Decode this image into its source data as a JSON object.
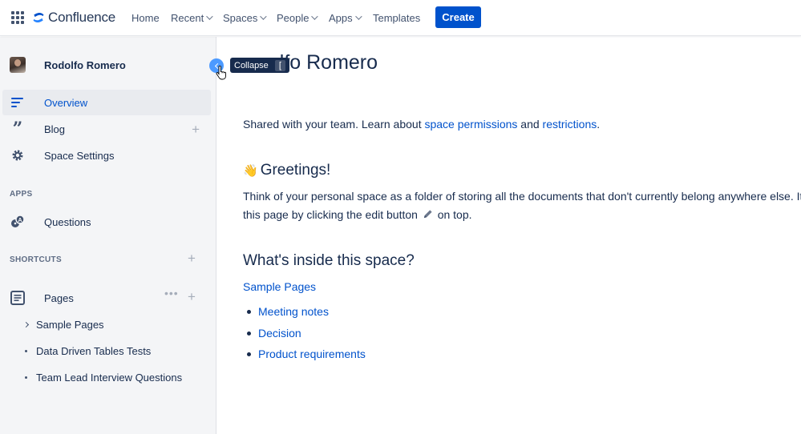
{
  "nav": {
    "brand": "Confluence",
    "items": [
      {
        "label": "Home",
        "has_dropdown": false
      },
      {
        "label": "Recent",
        "has_dropdown": true
      },
      {
        "label": "Spaces",
        "has_dropdown": true
      },
      {
        "label": "People",
        "has_dropdown": true
      },
      {
        "label": "Apps",
        "has_dropdown": true
      },
      {
        "label": "Templates",
        "has_dropdown": false
      }
    ],
    "create_label": "Create"
  },
  "sidebar": {
    "space_name": "Rodolfo Romero",
    "items": [
      {
        "label": "Overview",
        "icon": "overview-lines-icon",
        "active": true
      },
      {
        "label": "Blog",
        "icon": "quote-icon",
        "active": false
      },
      {
        "label": "Space Settings",
        "icon": "gear-icon",
        "active": false
      }
    ],
    "apps_title": "APPS",
    "apps": [
      {
        "label": "Questions",
        "icon": "questions-icon"
      }
    ],
    "shortcuts_title": "SHORTCUTS",
    "pages_label": "Pages",
    "tree": [
      {
        "label": "Sample Pages",
        "expandable": true
      },
      {
        "label": "Data Driven Tables Tests",
        "expandable": false
      },
      {
        "label": "Team Lead Interview Questions",
        "expandable": false
      }
    ]
  },
  "tooltip": {
    "text": "Collapse",
    "shortcut": "["
  },
  "content": {
    "title": "lfo Romero",
    "shared_prefix": "Shared with your team. Learn about ",
    "shared_link1": "space permissions",
    "shared_and": " and ",
    "shared_link2": "restrictions",
    "shared_suffix": ".",
    "greeting_emoji": "👋",
    "greeting_heading": "Greetings!",
    "greeting_line1": "Think of your personal space as a folder of storing all the documents that don't currently belong anywhere else. It's al",
    "greeting_line2a": "this page by clicking the edit button",
    "greeting_line2b": "on top.",
    "inside_heading": "What's inside this space?",
    "sample_pages_link": "Sample Pages",
    "list": [
      "Meeting notes",
      "Decision",
      "Product requirements"
    ]
  },
  "colors": {
    "brand_blue": "#0052cc",
    "sidebar_bg": "#f4f5f7",
    "collapse_blue": "#4c9aff",
    "text": "#172b4d"
  }
}
